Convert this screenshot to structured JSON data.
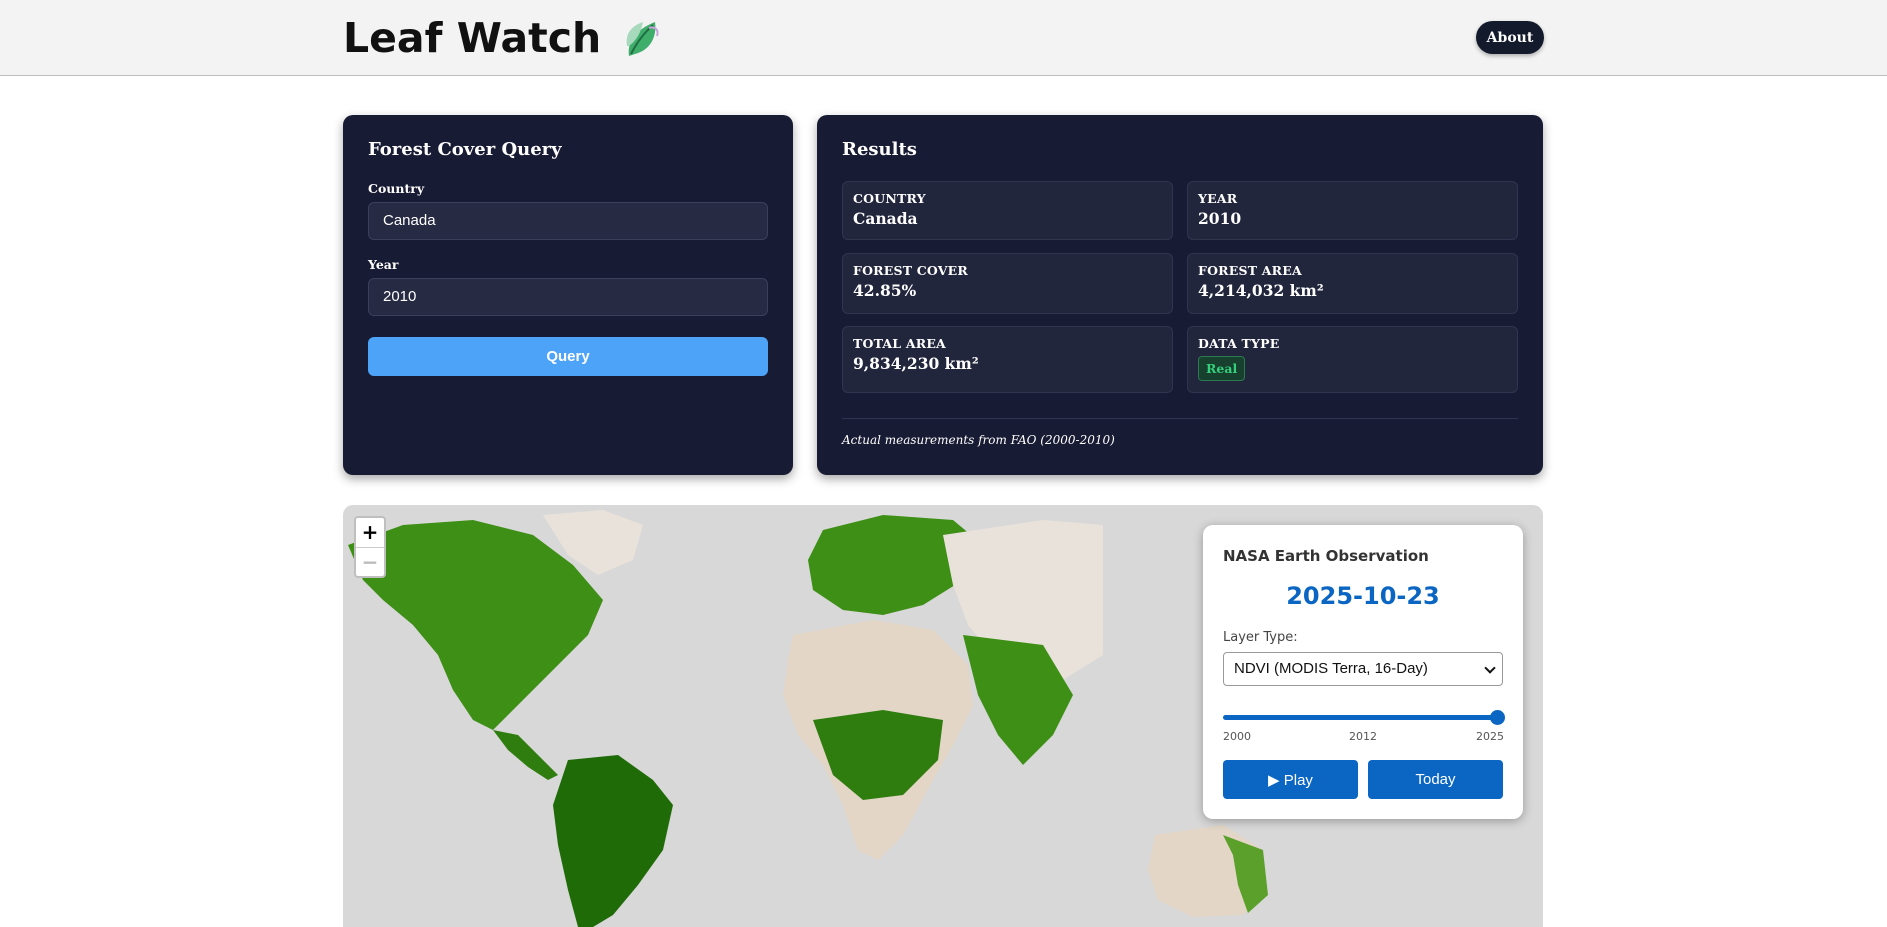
{
  "header": {
    "title": "Leaf Watch",
    "about_label": "About"
  },
  "query": {
    "title": "Forest Cover Query",
    "country_label": "Country",
    "country_value": "Canada",
    "year_label": "Year",
    "year_value": "2010",
    "submit_label": "Query"
  },
  "results": {
    "title": "Results",
    "stats": [
      {
        "label": "COUNTRY",
        "value": "Canada"
      },
      {
        "label": "YEAR",
        "value": "2010"
      },
      {
        "label": "FOREST COVER",
        "value": "42.85%"
      },
      {
        "label": "FOREST AREA",
        "value": "4,214,032 km²"
      },
      {
        "label": "TOTAL AREA",
        "value": "9,834,230 km²"
      },
      {
        "label": "DATA TYPE",
        "value": "Real"
      }
    ],
    "footnote": "Actual measurements from FAO (2000-2010)"
  },
  "map": {
    "zoom_in": "+",
    "zoom_out": "−"
  },
  "nasa": {
    "title": "NASA Earth Observation",
    "date": "2025-10-23",
    "layer_label": "Layer Type:",
    "layer_value": "NDVI (MODIS Terra, 16-Day)",
    "slider_min": "2000",
    "slider_mid": "2012",
    "slider_max": "2025",
    "slider_fraction": 1.0,
    "play_label": "▶ Play",
    "today_label": "Today"
  },
  "colors": {
    "card_bg": "#181b34",
    "accent_blue": "#4da3f7",
    "nasa_blue": "#0a66c2",
    "badge_green": "#35d07a",
    "forest_green": "#2e7d0e"
  }
}
